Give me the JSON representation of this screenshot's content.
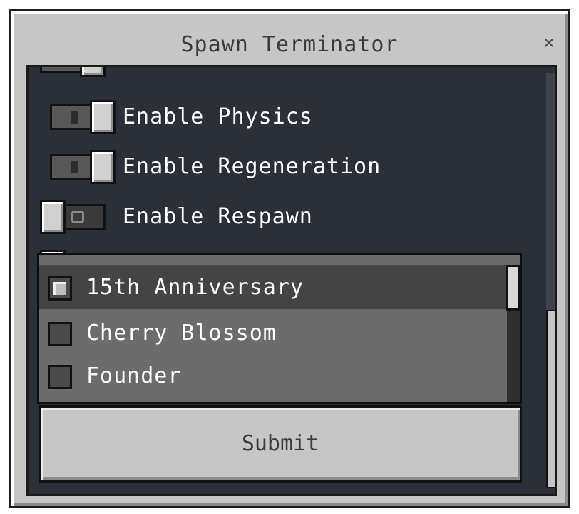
{
  "window": {
    "title": "Spawn Terminator",
    "close_label": "×"
  },
  "options": [
    {
      "label": "Enable Physics",
      "enabled": true
    },
    {
      "label": "Enable Regeneration",
      "enabled": true
    },
    {
      "label": "Enable Respawn",
      "enabled": false
    }
  ],
  "dropdown": {
    "items": [
      {
        "label": "15th Anniversary",
        "checked": true
      },
      {
        "label": "Cherry Blossom",
        "checked": false
      },
      {
        "label": "Founder",
        "checked": false
      }
    ]
  },
  "submit_label": "Submit"
}
